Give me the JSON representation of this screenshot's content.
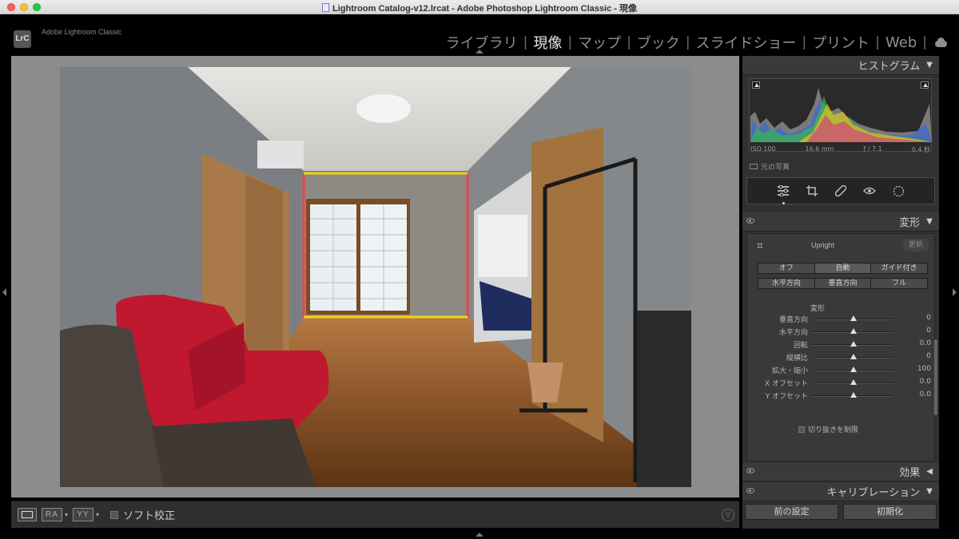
{
  "window": {
    "title": "Lightroom Catalog-v12.lrcat - Adobe Photoshop Lightroom Classic - 現像"
  },
  "identity": {
    "badge": "LrC",
    "app_name": "Adobe Lightroom Classic"
  },
  "modules": [
    {
      "label": "ライブラリ",
      "active": false
    },
    {
      "label": "現像",
      "active": true
    },
    {
      "label": "マップ",
      "active": false
    },
    {
      "label": "ブック",
      "active": false
    },
    {
      "label": "スライドショー",
      "active": false
    },
    {
      "label": "プリント",
      "active": false
    },
    {
      "label": "Web",
      "active": false
    }
  ],
  "toolbar": {
    "ra": "RA",
    "yy": "YY",
    "soft_proof": "ソフト校正"
  },
  "histogram": {
    "title": "ヒストグラム",
    "iso": "ISO 100",
    "focal": "16.6 mm",
    "aperture": "ƒ / 7.1",
    "shutter": "0.4 秒",
    "original": "元の写真"
  },
  "transform": {
    "title": "変形",
    "upright_label": "Upright",
    "update": "更新",
    "modes_row1": [
      "オフ",
      "自動",
      "ガイド付き"
    ],
    "modes_row2": [
      "水平方向",
      "垂直方向",
      "フル"
    ],
    "section": "変形",
    "sliders": [
      {
        "label": "垂直方向",
        "value": "0",
        "pos": 0.5
      },
      {
        "label": "水平方向",
        "value": "0",
        "pos": 0.5
      },
      {
        "label": "回転",
        "value": "0.0",
        "pos": 0.5
      },
      {
        "label": "縦横比",
        "value": "0",
        "pos": 0.5
      },
      {
        "label": "拡大・縮小",
        "value": "100",
        "pos": 0.5
      },
      {
        "label": "X オフセット",
        "value": "0.0",
        "pos": 0.5
      },
      {
        "label": "Y オフセット",
        "value": "0.0",
        "pos": 0.5
      }
    ],
    "constrain_crop": "切り抜きを制限"
  },
  "panels": {
    "effects": "効果",
    "calibration": "キャリブレーション"
  },
  "buttons": {
    "previous": "前の設定",
    "reset": "初期化"
  },
  "colors": {
    "guide_red": "#e8454a",
    "guide_yellow": "#f2d21a",
    "sofa": "#c0182f"
  }
}
